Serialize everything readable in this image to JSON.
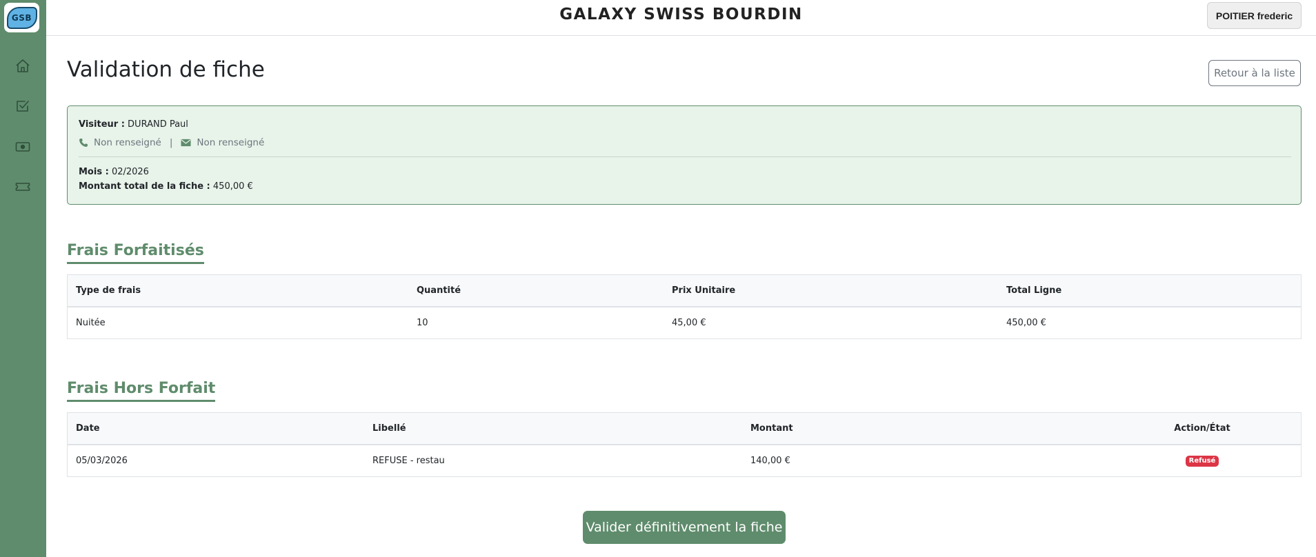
{
  "sidebar": {
    "logo_text": "GSB",
    "items": [
      {
        "icon": "home-icon"
      },
      {
        "icon": "checkbox-icon"
      },
      {
        "icon": "money-icon"
      },
      {
        "icon": "ticket-icon"
      }
    ]
  },
  "header": {
    "brand": "GALAXY SWISS BOURDIN",
    "user": "POITIER frederic"
  },
  "page": {
    "title": "Validation de fiche",
    "back_label": "Retour à la liste"
  },
  "info": {
    "visitor_label": "Visiteur :",
    "visitor_name": "DURAND Paul",
    "phone": "Non renseigné",
    "separator": "|",
    "email": "Non renseigné",
    "month_label": "Mois :",
    "month": "02/2026",
    "total_label": "Montant total de la fiche :",
    "total": "450,00 €"
  },
  "frais_forfaitises": {
    "title": "Frais Forfaitisés",
    "headers": [
      "Type de frais",
      "Quantité",
      "Prix Unitaire",
      "Total Ligne"
    ],
    "rows": [
      [
        "Nuitée",
        "10",
        "45,00 €",
        "450,00 €"
      ]
    ]
  },
  "frais_hors_forfait": {
    "title": "Frais Hors Forfait",
    "headers": [
      "Date",
      "Libellé",
      "Montant",
      "Action/État"
    ],
    "rows": [
      {
        "date": "05/03/2026",
        "libelle": "REFUSE - restau",
        "montant": "140,00 €",
        "etat": "Refusé"
      }
    ]
  },
  "actions": {
    "validate_label": "Valider définitivement la fiche"
  },
  "colors": {
    "accent": "#5f8c6c",
    "info_bg": "#e8f3ea",
    "danger": "#dc3545"
  }
}
